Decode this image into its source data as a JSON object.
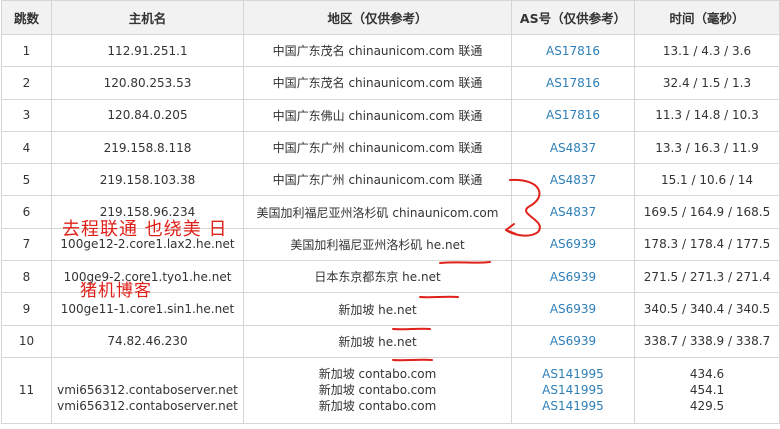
{
  "headers": {
    "hop": "跳数",
    "host": "主机名",
    "region": "地区（仅供参考）",
    "as": "AS号（仅供参考）",
    "time": "时间（毫秒）"
  },
  "rows": [
    {
      "hop": "1",
      "host": "112.91.251.1",
      "region": "中国广东茂名 chinaunicom.com 联通",
      "as": "AS17816",
      "time": "13.1 / 4.3 / 3.6"
    },
    {
      "hop": "2",
      "host": "120.80.253.53",
      "region": "中国广东茂名 chinaunicom.com 联通",
      "as": "AS17816",
      "time": "32.4 / 1.5 / 1.3"
    },
    {
      "hop": "3",
      "host": "120.84.0.205",
      "region": "中国广东佛山 chinaunicom.com 联通",
      "as": "AS17816",
      "time": "11.3 / 14.8 / 10.3"
    },
    {
      "hop": "4",
      "host": "219.158.8.118",
      "region": "中国广东广州 chinaunicom.com 联通",
      "as": "AS4837",
      "time": "13.3 / 16.3 / 11.9"
    },
    {
      "hop": "5",
      "host": "219.158.103.38",
      "region": "中国广东广州 chinaunicom.com 联通",
      "as": "AS4837",
      "time": "15.1 / 10.6 / 14"
    },
    {
      "hop": "6",
      "host": "219.158.96.234",
      "region": "美国加利福尼亚州洛杉矶 chinaunicom.com",
      "as": "AS4837",
      "time": "169.5 / 164.9 / 168.5"
    },
    {
      "hop": "7",
      "host": "100ge12-2.core1.lax2.he.net",
      "region": "美国加利福尼亚州洛杉矶 he.net",
      "as": "AS6939",
      "time": "178.3 / 178.4 / 177.5"
    },
    {
      "hop": "8",
      "host": "100ge9-2.core1.tyo1.he.net",
      "region": "日本东京都东京 he.net",
      "as": "AS6939",
      "time": "271.5 / 271.3 / 271.4"
    },
    {
      "hop": "9",
      "host": "100ge11-1.core1.sin1.he.net",
      "region": "新加坡 he.net",
      "as": "AS6939",
      "time": "340.5 / 340.4 / 340.5"
    },
    {
      "hop": "10",
      "host": "74.82.46.230",
      "region": "新加坡 he.net",
      "as": "AS6939",
      "time": "338.7 / 338.9 / 338.7"
    }
  ],
  "row11": {
    "hop": "11",
    "hosts": [
      "vmi656312.contaboserver.net",
      "vmi656312.contaboserver.net"
    ],
    "regions": [
      "新加坡 contabo.com",
      "新加坡 contabo.com",
      "新加坡 contabo.com"
    ],
    "as": [
      "AS141995",
      "AS141995",
      "AS141995"
    ],
    "times": [
      "434.6",
      "454.1",
      "429.5"
    ]
  },
  "annotations": {
    "line1": "去程联通 也绕美 日",
    "line2": "猪机博客"
  }
}
